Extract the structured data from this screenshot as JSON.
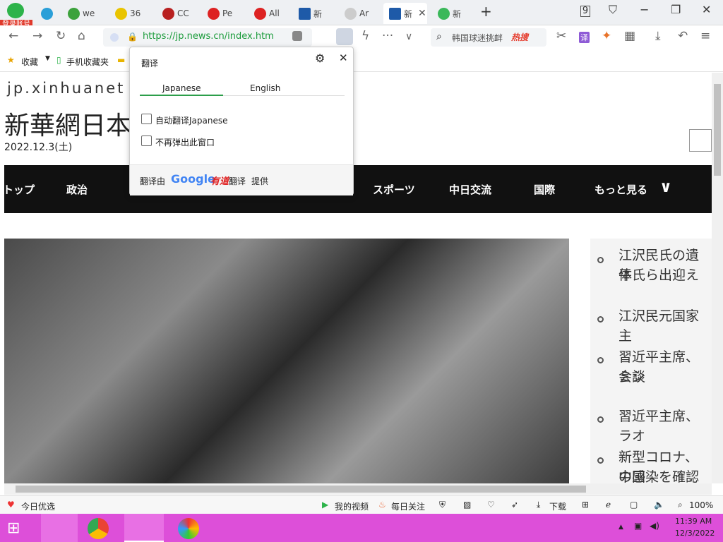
{
  "tabs": [
    "we",
    "36",
    "CC",
    "Pe",
    "All",
    "新",
    "Ar",
    "新",
    "新"
  ],
  "login_badge": "登录账号",
  "url": "https://jp.news.cn/index.htm",
  "search_text": "韩国球迷挑衅",
  "hot_search": "热搜",
  "bookmarks": {
    "b1": "收藏",
    "b2": "手机收藏夹"
  },
  "site": {
    "domain": "jp.xinhuanet",
    "title": "新華網日本",
    "date": "2022.12.3(土)"
  },
  "nav": [
    "トップ",
    "政治",
    "スポーツ",
    "中日交流",
    "国際",
    "もっと見る"
  ],
  "news": [
    "江沢民氏の遺体",
    "平氏ら出迎え",
    "江沢民元国家主",
    "習近平主席、ミシ",
    "会談",
    "習近平主席、ラオ",
    "新型コロナ、中国",
    "の感染を確認"
  ],
  "popup": {
    "title": "翻译",
    "tab1": "Japanese",
    "tab2": "English",
    "opt1": "自动翻译Japanese",
    "opt2": "不再弹出此窗口",
    "footer1": "翻译由",
    "footer2": "翻译",
    "footer3": "提供",
    "google": "Google",
    "youdao": "有道"
  },
  "status": {
    "left": "今日优选",
    "video": "我的视频",
    "daily": "每日关注",
    "download": "下载",
    "zoom": "100%"
  },
  "clock": {
    "time": "11:39 AM",
    "date": "12/3/2022"
  }
}
